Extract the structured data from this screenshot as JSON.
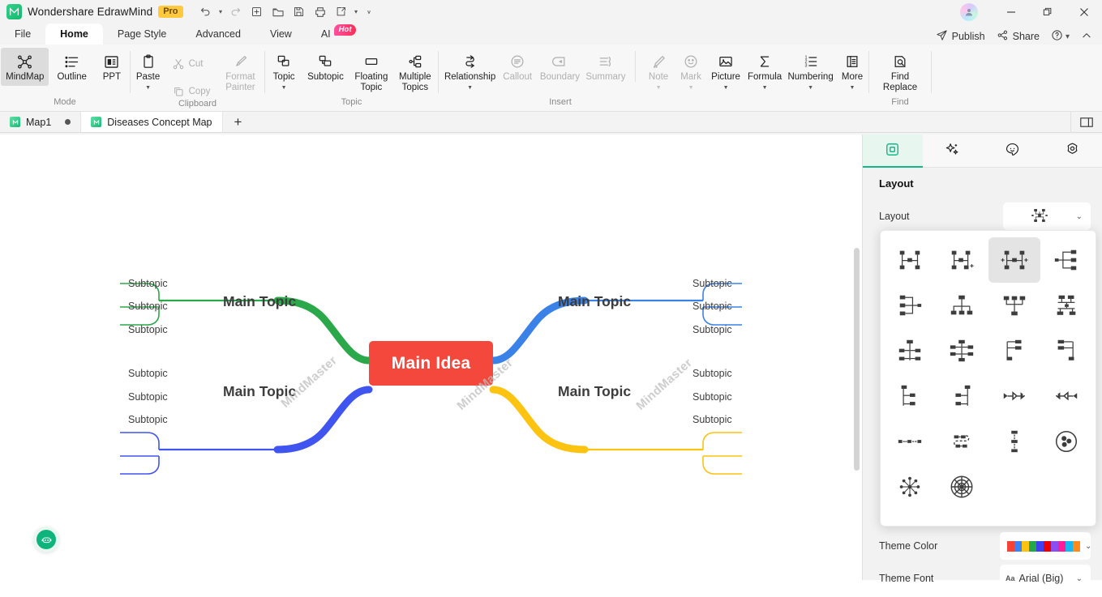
{
  "titlebar": {
    "app_name": "Wondershare EdrawMind",
    "pro_badge": "Pro",
    "quick_access": [
      {
        "name": "undo-icon",
        "label": "Undo"
      },
      {
        "name": "undo-dropdown-icon",
        "label": "Undo options"
      },
      {
        "name": "redo-icon",
        "label": "Redo"
      },
      {
        "name": "new-icon",
        "label": "New"
      },
      {
        "name": "open-icon",
        "label": "Open"
      },
      {
        "name": "save-icon",
        "label": "Save"
      },
      {
        "name": "print-icon",
        "label": "Print"
      },
      {
        "name": "export-icon",
        "label": "Export"
      },
      {
        "name": "export-dropdown-icon",
        "label": "Export options"
      },
      {
        "name": "customize-qat-icon",
        "label": "Customize"
      }
    ],
    "window": {
      "minimize": "–",
      "maximize": "❐",
      "close": "✕"
    }
  },
  "menu": {
    "tabs": [
      {
        "label": "File",
        "active": false
      },
      {
        "label": "Home",
        "active": true
      },
      {
        "label": "Page Style",
        "active": false
      },
      {
        "label": "Advanced",
        "active": false
      },
      {
        "label": "View",
        "active": false
      },
      {
        "label": "AI",
        "active": false,
        "badge": "Hot"
      }
    ],
    "right": [
      {
        "label": "Publish",
        "icon": "publish-icon"
      },
      {
        "label": "Share",
        "icon": "share-icon"
      },
      {
        "label": "",
        "icon": "help-icon"
      },
      {
        "label": "",
        "icon": "collapse-ribbon-icon"
      }
    ]
  },
  "ribbon": {
    "groups": [
      {
        "name": "Mode",
        "buttons": [
          {
            "label": "MindMap",
            "icon": "mindmap-icon",
            "selected": true,
            "disabled": false
          },
          {
            "label": "Outline",
            "icon": "outline-icon",
            "selected": false,
            "disabled": false
          },
          {
            "label": "PPT",
            "icon": "ppt-icon",
            "selected": false,
            "disabled": false
          }
        ]
      },
      {
        "name": "Clipboard",
        "buttons": [
          {
            "label": "Paste",
            "icon": "paste-icon",
            "dropdown": true,
            "disabled": false
          },
          {
            "label": "Cut",
            "icon": "cut-icon",
            "disabled": true
          },
          {
            "label": "Copy",
            "icon": "copy-icon",
            "disabled": true
          },
          {
            "label": "Format Painter",
            "icon": "format-painter-icon",
            "disabled": true
          }
        ]
      },
      {
        "name": "Topic",
        "buttons": [
          {
            "label": "Topic",
            "icon": "topic-icon",
            "dropdown": true,
            "disabled": false
          },
          {
            "label": "Subtopic",
            "icon": "subtopic-icon",
            "disabled": false
          },
          {
            "label": "Floating Topic",
            "icon": "floating-topic-icon",
            "disabled": false
          },
          {
            "label": "Multiple Topics",
            "icon": "multiple-topics-icon",
            "disabled": false
          }
        ]
      },
      {
        "name": "Insert",
        "buttons": [
          {
            "label": "Relationship",
            "icon": "relationship-icon",
            "dropdown": true,
            "disabled": false
          },
          {
            "label": "Callout",
            "icon": "callout-icon",
            "disabled": true
          },
          {
            "label": "Boundary",
            "icon": "boundary-icon",
            "disabled": true
          },
          {
            "label": "Summary",
            "icon": "summary-icon",
            "disabled": true
          },
          {
            "label": "Note",
            "icon": "note-icon",
            "dropdown": true,
            "disabled": true
          },
          {
            "label": "Mark",
            "icon": "mark-icon",
            "dropdown": true,
            "disabled": true
          },
          {
            "label": "Picture",
            "icon": "picture-icon",
            "dropdown": true,
            "disabled": false
          },
          {
            "label": "Formula",
            "icon": "formula-icon",
            "dropdown": true,
            "disabled": false
          },
          {
            "label": "Numbering",
            "icon": "numbering-icon",
            "dropdown": true,
            "disabled": false
          },
          {
            "label": "More",
            "icon": "more-icon",
            "dropdown": true,
            "disabled": false
          }
        ]
      },
      {
        "name": "Find",
        "buttons": [
          {
            "label": "Find Replace",
            "icon": "find-replace-icon",
            "disabled": false
          }
        ]
      }
    ]
  },
  "doctabs": {
    "tabs": [
      {
        "label": "Map1",
        "active": false,
        "modified": true
      },
      {
        "label": "Diseases Concept Map",
        "active": true,
        "modified": false
      }
    ],
    "add_label": "+",
    "panel_toggle_icon": "panel-toggle-icon"
  },
  "canvas": {
    "watermarks": [
      "MindMaster",
      "MindMaster",
      "MindMaster"
    ],
    "ai_assistant_icon": "ai-robot-icon",
    "mindmap": {
      "center": {
        "text": "Main Idea",
        "color": "#f4483c"
      },
      "branches": [
        {
          "topic": "Main Topic",
          "color": "#2ba84a",
          "side": "left",
          "position": "top",
          "subtopics": [
            "Subtopic",
            "Subtopic",
            "Subtopic"
          ]
        },
        {
          "topic": "Main Topic",
          "color": "#4054f0",
          "side": "left",
          "position": "bottom",
          "subtopics": [
            "Subtopic",
            "Subtopic",
            "Subtopic"
          ]
        },
        {
          "topic": "Main Topic",
          "color": "#3b82e8",
          "side": "right",
          "position": "top",
          "subtopics": [
            "Subtopic",
            "Subtopic",
            "Subtopic"
          ]
        },
        {
          "topic": "Main Topic",
          "color": "#fcc310",
          "side": "right",
          "position": "bottom",
          "subtopics": [
            "Subtopic",
            "Subtopic",
            "Subtopic"
          ]
        }
      ]
    }
  },
  "right_panel": {
    "tabs": [
      {
        "icon": "layout-panel-icon",
        "active": true
      },
      {
        "icon": "ai-sparkle-icon",
        "active": false
      },
      {
        "icon": "smiley-clipart-icon",
        "active": false
      },
      {
        "icon": "settings-gear-icon",
        "active": false
      }
    ],
    "title": "Layout",
    "layout_row_label": "Layout",
    "layout_selected_icon": "layout-balanced-map-icon",
    "layout_options": [
      {
        "name": "layout-org-chart-icon",
        "selected": false
      },
      {
        "name": "layout-org-chart-plus-icon",
        "selected": false
      },
      {
        "name": "layout-balanced-map-icon",
        "selected": true
      },
      {
        "name": "layout-right-tree-icon",
        "selected": false
      },
      {
        "name": "layout-left-tree-icon",
        "selected": false
      },
      {
        "name": "layout-downward-tree-icon",
        "selected": false
      },
      {
        "name": "layout-upward-tree-icon",
        "selected": false
      },
      {
        "name": "layout-horizontal-split-icon",
        "selected": false
      },
      {
        "name": "layout-vertical-balance-icon",
        "selected": false
      },
      {
        "name": "layout-two-sided-tree-icon",
        "selected": false
      },
      {
        "name": "layout-right-logic-icon",
        "selected": false
      },
      {
        "name": "layout-left-logic-icon",
        "selected": false
      },
      {
        "name": "layout-bracket-right-icon",
        "selected": false
      },
      {
        "name": "layout-bracket-left-icon",
        "selected": false
      },
      {
        "name": "layout-fishbone-right-icon",
        "selected": false
      },
      {
        "name": "layout-fishbone-left-icon",
        "selected": false
      },
      {
        "name": "layout-timeline-icon",
        "selected": false
      },
      {
        "name": "layout-snake-timeline-icon",
        "selected": false
      },
      {
        "name": "layout-vertical-timeline-icon",
        "selected": false
      },
      {
        "name": "layout-circular-group-icon",
        "selected": false
      },
      {
        "name": "layout-radial-icon",
        "selected": false
      },
      {
        "name": "layout-target-icon",
        "selected": false
      }
    ],
    "theme_color_label": "Theme Color",
    "theme_colors": [
      "#f44336",
      "#3b82f6",
      "#fcc310",
      "#22a84a",
      "#4040f0",
      "#ee0000",
      "#8a4ff0",
      "#ff1a9a",
      "#17b6f0",
      "#ff8a1a"
    ],
    "theme_font_label": "Theme Font",
    "theme_font_value": "Arial (Big)",
    "theme_font_prefix": "Aa"
  }
}
